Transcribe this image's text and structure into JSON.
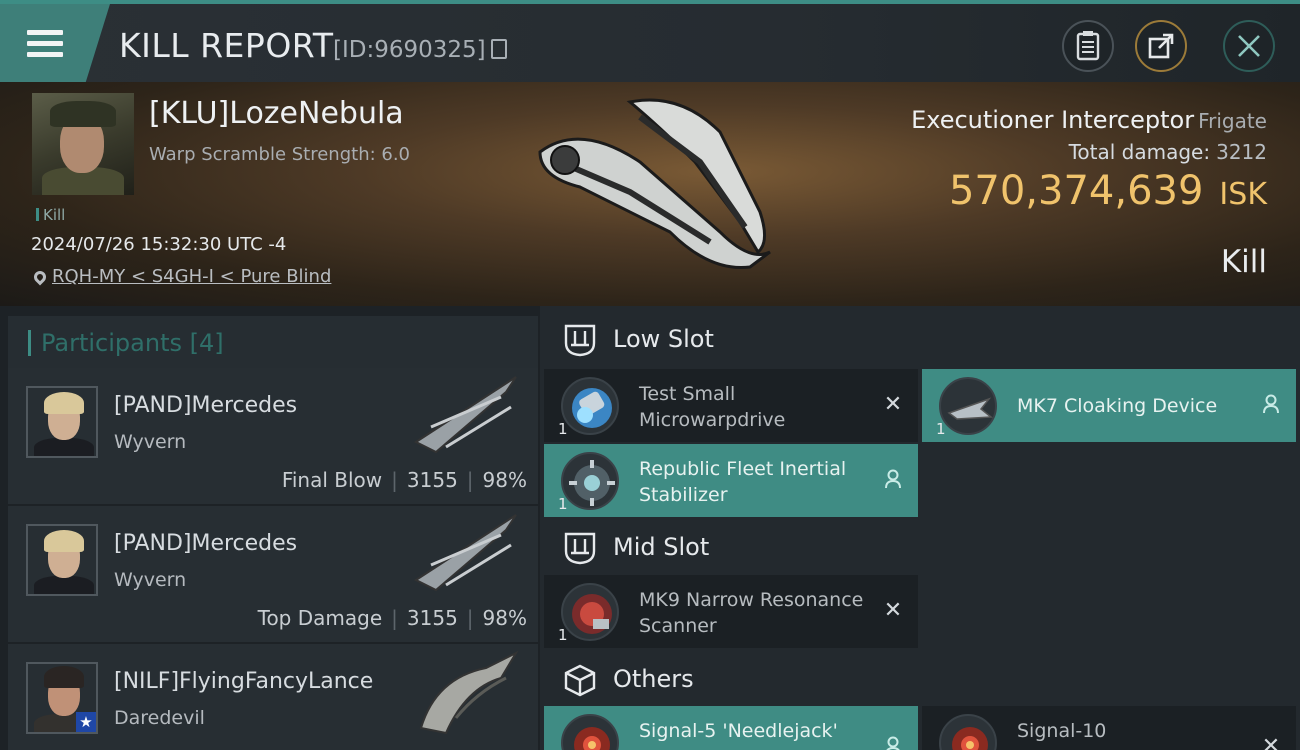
{
  "header": {
    "title": "KILL REPORT",
    "id_text": "[ID:9690325]",
    "icons": [
      "menu-icon",
      "copy-icon",
      "clipboard-icon",
      "share-icon",
      "close-icon"
    ]
  },
  "victim": {
    "name": "[KLU]LozeNebula",
    "subtitle": "Warp Scramble Strength: 6.0",
    "tag": "Kill",
    "datetime": "2024/07/26 15:32:30 UTC -4",
    "location": "RQH-MY < S4GH-I < Pure Blind",
    "ship": "Executioner Interceptor",
    "ship_class": "Frigate",
    "total_damage_label": "Total damage:",
    "total_damage": "3212",
    "isk_value": "570,374,639",
    "isk_unit": "ISK",
    "result": "Kill"
  },
  "participants": {
    "label": "Participants",
    "count": "[4]",
    "rows": [
      {
        "name": "[PAND]Mercedes",
        "ship": "Wyvern",
        "role": "Final Blow",
        "damage": "3155",
        "percent": "98%"
      },
      {
        "name": "[PAND]Mercedes",
        "ship": "Wyvern",
        "role": "Top Damage",
        "damage": "3155",
        "percent": "98%"
      },
      {
        "name": "[NILF]FlyingFancyLance",
        "ship": "Daredevil"
      }
    ]
  },
  "fitting": {
    "low_slot": {
      "label": "Low Slot",
      "modules": [
        {
          "name": "Test Small Microwarpdrive",
          "qty": "1",
          "state": "destroyed"
        },
        {
          "name": "MK7 Cloaking Device",
          "qty": "1",
          "state": "dropped"
        },
        {
          "name": "Republic Fleet Inertial Stabilizer",
          "qty": "1",
          "state": "dropped"
        }
      ]
    },
    "mid_slot": {
      "label": "Mid Slot",
      "modules": [
        {
          "name": "MK9 Narrow Resonance Scanner",
          "qty": "1",
          "state": "destroyed"
        }
      ]
    },
    "others": {
      "label": "Others",
      "modules": [
        {
          "name": "Signal-5 'Needlejack'",
          "state": "dropped"
        },
        {
          "name": "Signal-10",
          "state": "destroyed"
        }
      ]
    }
  },
  "colors": {
    "accent": "#3d8d85",
    "isk": "#f0c36c",
    "selected_row": "#3f8c84"
  }
}
